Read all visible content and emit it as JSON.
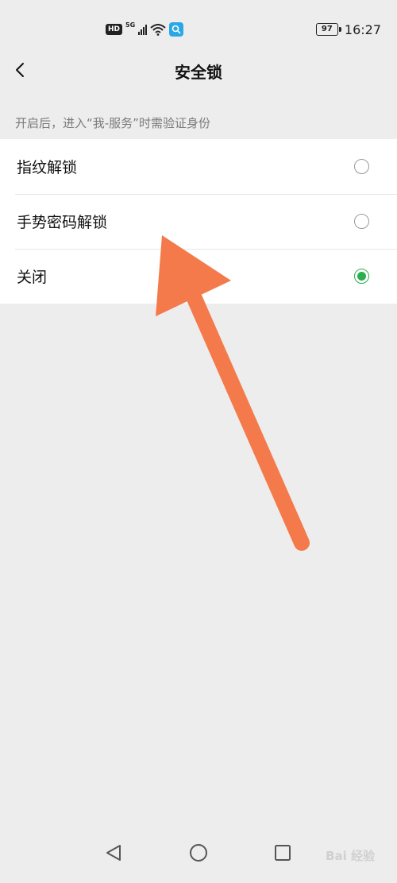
{
  "status_bar": {
    "hd_label": "HD",
    "network_label": "5G",
    "battery": "97",
    "time": "16:27"
  },
  "header": {
    "title": "安全锁"
  },
  "hint": "开启后，进入“我-服务”时需验证身份",
  "options": [
    {
      "label": "指纹解锁",
      "selected": false
    },
    {
      "label": "手势密码解锁",
      "selected": false
    },
    {
      "label": "关闭",
      "selected": true
    }
  ],
  "annotation": {
    "color": "#f47a4b"
  },
  "watermark": {
    "text": "Bai  经验"
  },
  "colors": {
    "accent": "#2aae50",
    "background": "#ededed"
  }
}
